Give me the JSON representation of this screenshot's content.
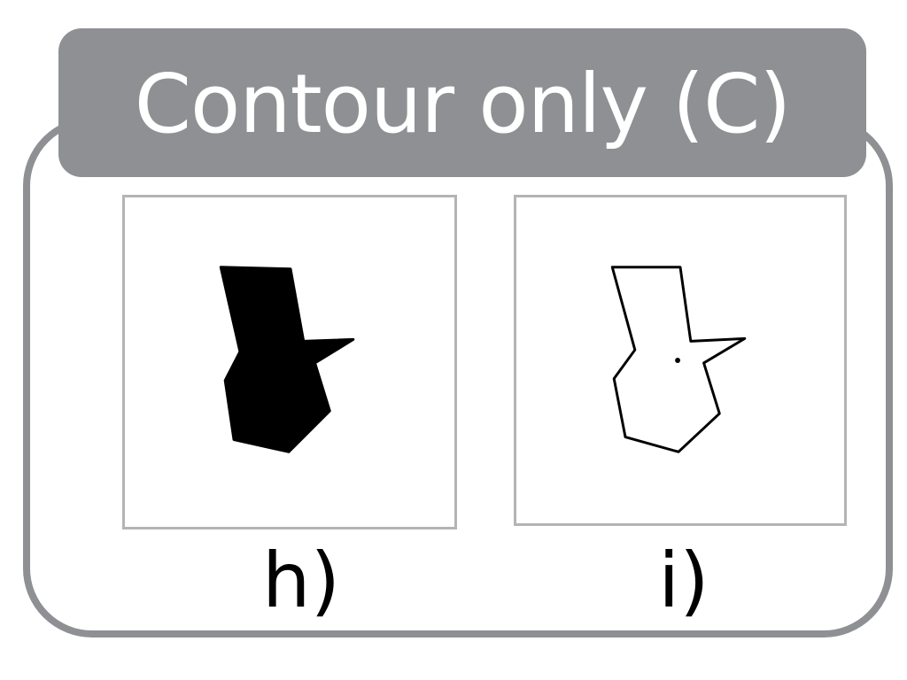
{
  "header": {
    "title": "Contour only (C)"
  },
  "panels": [
    {
      "label": "h)",
      "rendering": "filled silhouette"
    },
    {
      "label": "i)",
      "rendering": "outline contour with fixation dot"
    }
  ],
  "colors": {
    "frame": "#8e9094",
    "panel_border": "#b4b4b4",
    "shape": "#000000",
    "title_text": "#ffffff"
  }
}
